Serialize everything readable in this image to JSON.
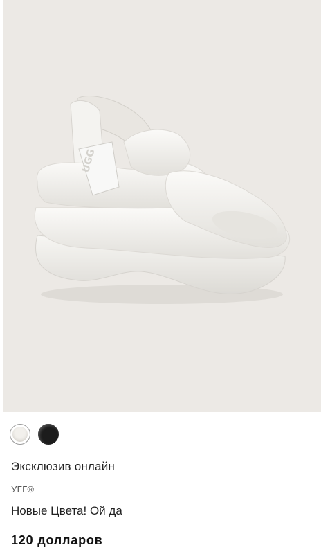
{
  "product": {
    "image_alt": "Белая сандалия на платформе",
    "badge": "Эксклюзив онлайн",
    "brand": "УГГ®",
    "name": "Новые Цвета! Ой да",
    "price": "120 долларов",
    "strap_logo": "UGG"
  },
  "swatches": [
    {
      "color": "#f2f0ec",
      "selected": true
    },
    {
      "color": "#1c1c1c",
      "selected": false
    }
  ],
  "colors": {
    "image_background": "#ece9e5"
  }
}
